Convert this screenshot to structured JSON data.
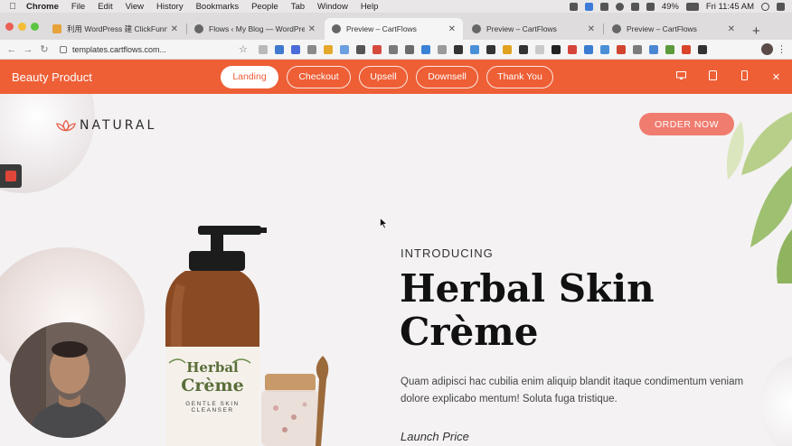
{
  "menubar": {
    "app": "Chrome",
    "items": [
      "File",
      "Edit",
      "View",
      "History",
      "Bookmarks",
      "People",
      "Tab",
      "Window",
      "Help"
    ],
    "battery": "49%",
    "clock": "Fri 11:45 AM"
  },
  "tabs": [
    {
      "title": "利用 WordPress 建 ClickFunnels"
    },
    {
      "title": "Flows ‹ My Blog — WordPress"
    },
    {
      "title": "Preview – CartFlows"
    },
    {
      "title": "Preview – CartFlows"
    },
    {
      "title": "Preview – CartFlows"
    }
  ],
  "toolbar": {
    "url": "templates.cartflows.com..."
  },
  "preview_bar": {
    "product_name": "Beauty Product",
    "steps": [
      "Landing",
      "Checkout",
      "Upsell",
      "Downsell",
      "Thank You"
    ],
    "active_step": "Landing",
    "close_glyph": "✕"
  },
  "page": {
    "logo_text": "NATURAL",
    "order_button": "ORDER NOW",
    "intro": "INTRODUCING",
    "headline_line1": "Herbal Skin",
    "headline_line2": "Crème",
    "body": "Quam adipisci hac cubilia enim aliquip blandit itaque condimentum veniam dolore explicabo mentum!  Soluta fuga tristique.",
    "launch": "Launch Price"
  },
  "product": {
    "label_line1": "Herbal",
    "label_line2": "Crème",
    "label_line3": "GENTLE SKIN",
    "label_line4": "CLEANSER"
  },
  "colors": {
    "accent": "#ee5f36",
    "order_button": "#ef7c6f"
  }
}
